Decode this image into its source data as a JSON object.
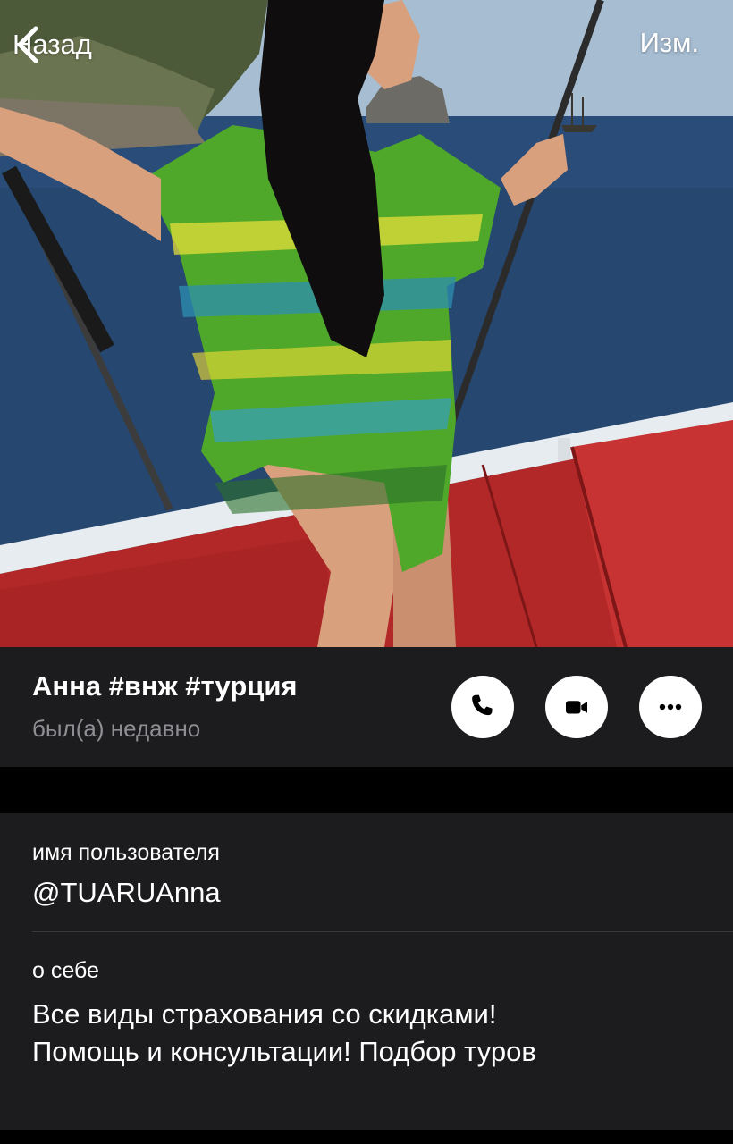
{
  "nav": {
    "back_label": "Назад",
    "edit_label": "Изм."
  },
  "profile": {
    "name": "Анна #внж #турция",
    "status": "был(а) недавно",
    "actions": {
      "call_icon": "phone-icon",
      "video_icon": "video-camera-icon",
      "more_icon": "ellipsis-icon"
    }
  },
  "info": {
    "username_label": "имя пользователя",
    "username_value": "@TUARUAnna",
    "bio_label": "о себе",
    "bio_line1": "Все виды страхования со скидками!",
    "bio_line2": "Помощь и консультации! Подбор туров"
  },
  "colors": {
    "background": "#000000",
    "card": "#1c1c1e",
    "secondary_text": "#8e8e93",
    "separator": "#38383a",
    "button": "#ffffff"
  }
}
